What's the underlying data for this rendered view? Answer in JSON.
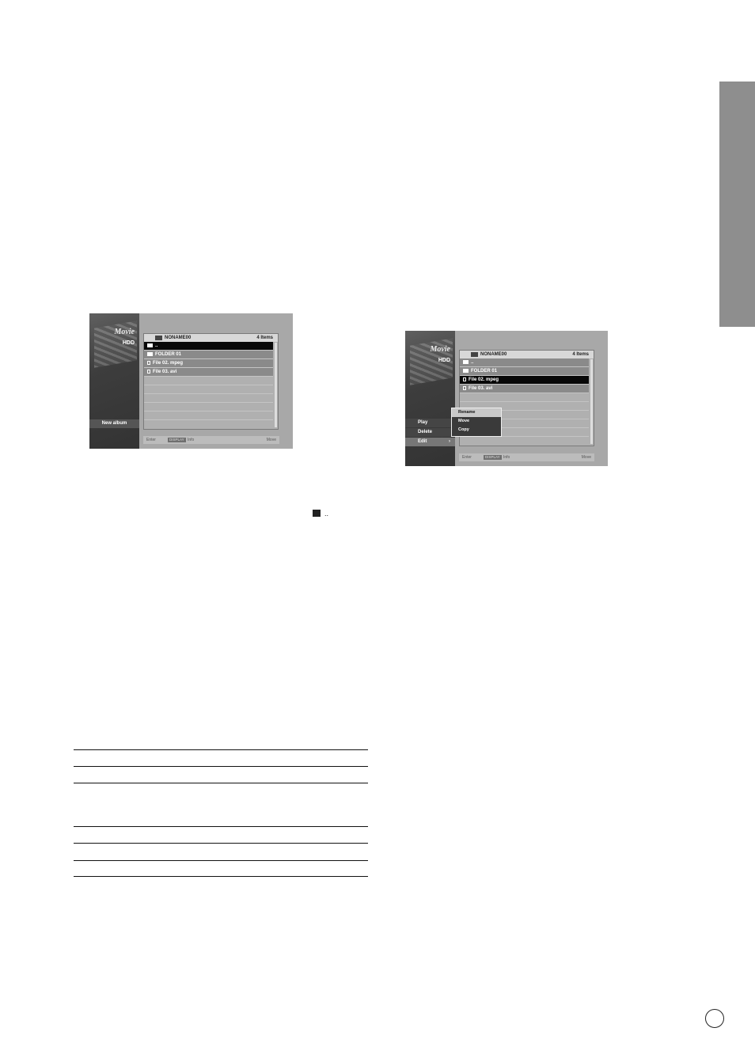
{
  "screen1": {
    "movie_title": "Movie",
    "drive": "HDD",
    "folder_name": "NONAME00",
    "item_count": "4 Items",
    "rows": [
      "..",
      "FOLDER 01",
      "File 02. mpeg",
      "File 03. avi"
    ],
    "left_button": "New album",
    "footer": {
      "enter": "Enter",
      "display": "DISPLAY",
      "info": "Info",
      "move": "Move"
    }
  },
  "screen2": {
    "movie_title": "Movie",
    "drive": "HDD",
    "folder_name": "NONAME00",
    "item_count": "4 Items",
    "rows": [
      "..",
      "FOLDER 01",
      "File 02. mpeg",
      "File 03. avi"
    ],
    "menu": [
      "Play",
      "Delete",
      "Edit"
    ],
    "submenu": [
      "Rename",
      "Move",
      "Copy"
    ],
    "footer": {
      "enter": "Enter",
      "display": "DISPLAY",
      "info": "Info",
      "move": "Move"
    }
  },
  "inline_symbol": ".."
}
